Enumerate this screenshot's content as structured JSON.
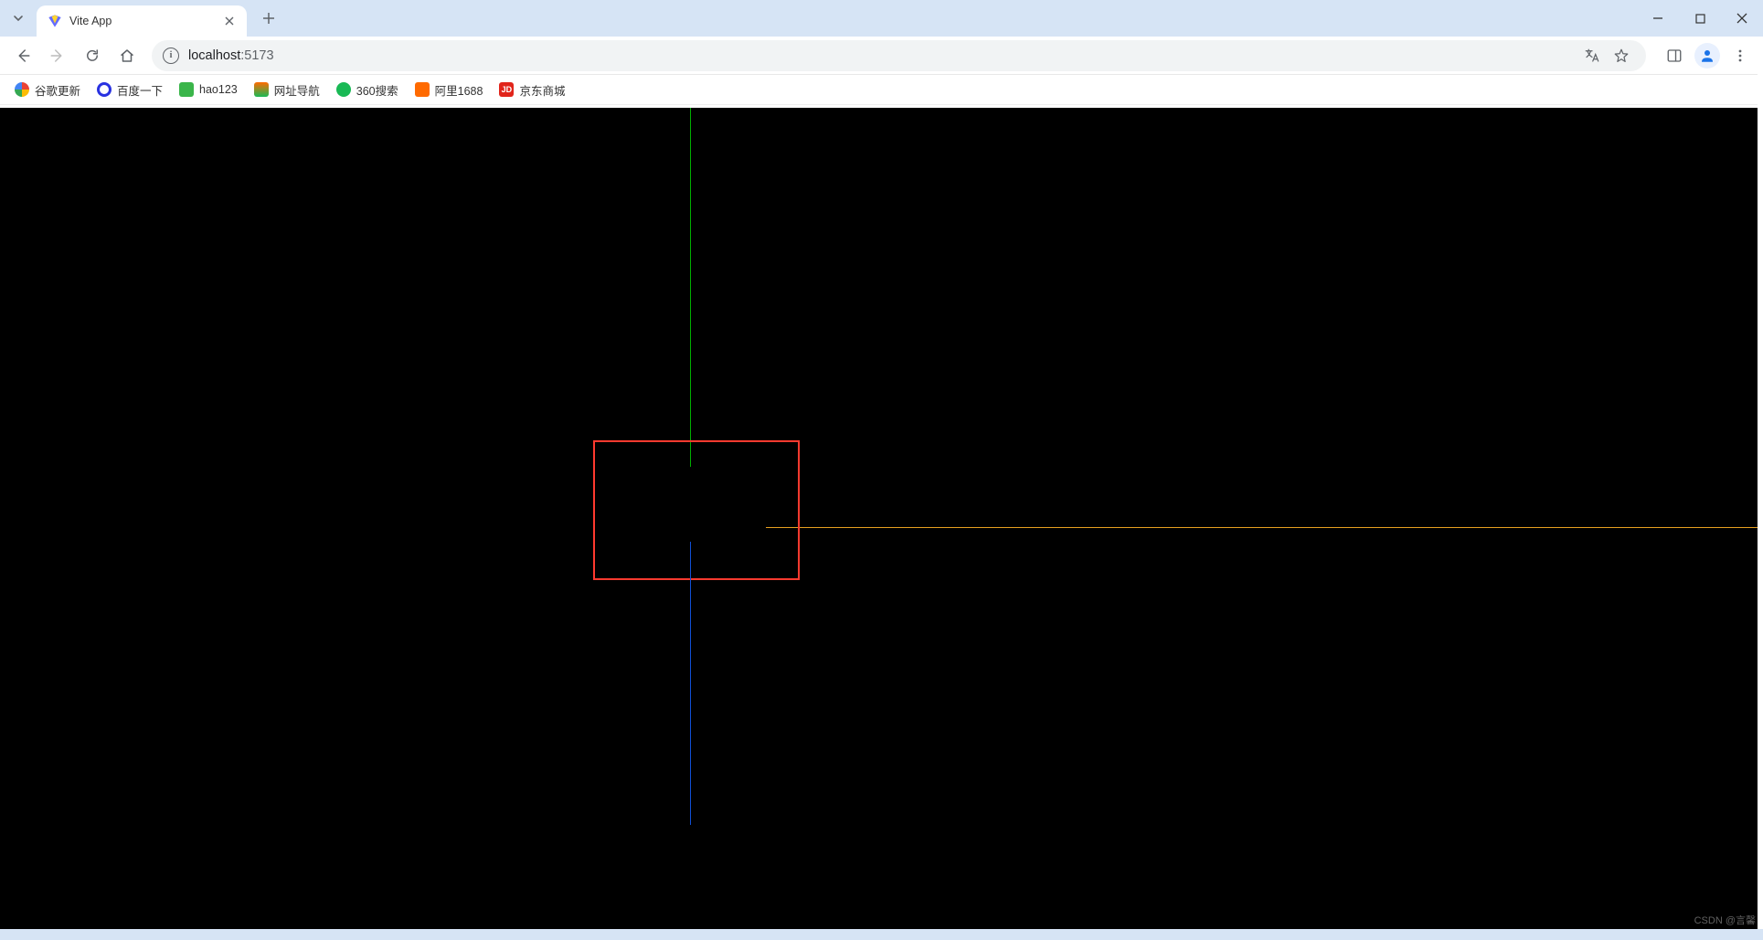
{
  "tab": {
    "title": "Vite App"
  },
  "address": {
    "host": "localhost",
    "port": ":5173"
  },
  "bookmarks": [
    {
      "label": "谷歌更新",
      "icon_color": "linear-gradient(135deg,#ea4335 0%,#fbbc05 33%,#34a853 66%,#4285f4 100%)",
      "icon_text": ""
    },
    {
      "label": "百度一下",
      "icon_color": "#2932e1",
      "icon_text": ""
    },
    {
      "label": "hao123",
      "icon_color": "#3ab54a",
      "icon_text": ""
    },
    {
      "label": "网址导航",
      "icon_color": "#ff6a00",
      "icon_text": ""
    },
    {
      "label": "360搜索",
      "icon_color": "#19b955",
      "icon_text": ""
    },
    {
      "label": "阿里1688",
      "icon_color": "#ff6a00",
      "icon_text": ""
    },
    {
      "label": "京东商城",
      "icon_color": "#e1251b",
      "icon_text": "JD"
    }
  ],
  "viewport": {
    "background": "#000000",
    "axes": {
      "y_positive_color": "#00b000",
      "y_negative_color": "#1050d6",
      "x_positive_color": "#e8a020"
    },
    "camera_rect": {
      "border_color": "#ff3a2f"
    }
  },
  "watermark": "CSDN @言馨"
}
